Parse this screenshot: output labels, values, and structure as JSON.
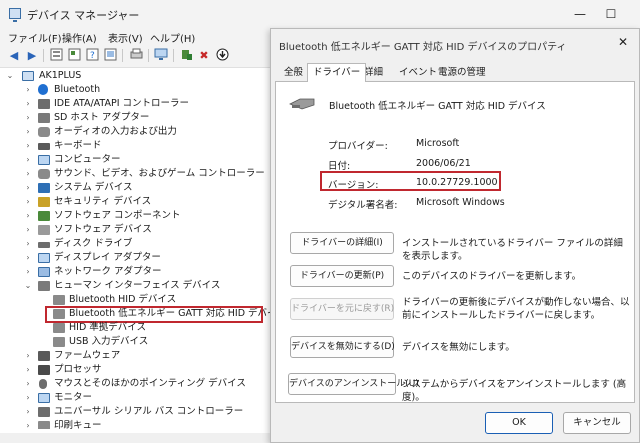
{
  "device_manager": {
    "title": "デバイス マネージャー",
    "window_controls": {
      "minimize": "—",
      "maximize": "☐",
      "close": "✕"
    },
    "menu": [
      "ファイル(F)",
      "操作(A)",
      "表示(V)",
      "ヘルプ(H)"
    ],
    "toolbar_icons": [
      "back-icon",
      "forward-icon",
      "properties-icon",
      "driver-icon",
      "help-icon",
      "view-icon",
      "print-icon",
      "monitor-icon",
      "update-driver-icon",
      "uninstall-icon",
      "scan-icon"
    ],
    "tree": {
      "root": "AK1PLUS",
      "categories": [
        {
          "label": "Bluetooth",
          "expanded": false
        },
        {
          "label": "IDE ATA/ATAPI コントローラー",
          "expanded": false
        },
        {
          "label": "SD ホスト アダプター",
          "expanded": false
        },
        {
          "label": "オーディオの入力および出力",
          "expanded": false
        },
        {
          "label": "キーボード",
          "expanded": false
        },
        {
          "label": "コンピューター",
          "expanded": false
        },
        {
          "label": "サウンド、ビデオ、およびゲーム コントローラー",
          "expanded": false
        },
        {
          "label": "システム デバイス",
          "expanded": false
        },
        {
          "label": "セキュリティ デバイス",
          "expanded": false
        },
        {
          "label": "ソフトウェア コンポーネント",
          "expanded": false
        },
        {
          "label": "ソフトウェア デバイス",
          "expanded": false
        },
        {
          "label": "ディスク ドライブ",
          "expanded": false
        },
        {
          "label": "ディスプレイ アダプター",
          "expanded": false
        },
        {
          "label": "ネットワーク アダプター",
          "expanded": false
        },
        {
          "label": "ヒューマン インターフェイス デバイス",
          "expanded": true,
          "children": [
            "Bluetooth HID デバイス",
            "Bluetooth 低エネルギー GATT 対応 HID デバイス",
            "HID 準拠デバイス",
            "USB 入力デバイス"
          ]
        },
        {
          "label": "ファームウェア",
          "expanded": false
        },
        {
          "label": "プロセッサ",
          "expanded": false
        },
        {
          "label": "マウスとそのほかのポインティング デバイス",
          "expanded": false
        },
        {
          "label": "モニター",
          "expanded": false
        },
        {
          "label": "ユニバーサル シリアル バス コントローラー",
          "expanded": false
        },
        {
          "label": "印刷キュー",
          "expanded": false
        }
      ],
      "selected_child": "Bluetooth 低エネルギー GATT 対応 HID デバイス"
    }
  },
  "properties_dialog": {
    "title": "Bluetooth 低エネルギー GATT 対応 HID デバイスのプロパティ",
    "close": "✕",
    "tabs": [
      "全般",
      "ドライバー",
      "詳細",
      "イベント",
      "電源の管理"
    ],
    "active_tab": "ドライバー",
    "device_name": "Bluetooth 低エネルギー GATT 対応 HID デバイス",
    "properties": {
      "provider_label": "プロバイダー:",
      "provider_value": "Microsoft",
      "date_label": "日付:",
      "date_value": "2006/06/21",
      "version_label": "バージョン:",
      "version_value": "10.0.27729.1000",
      "signer_label": "デジタル署名者:",
      "signer_value": "Microsoft Windows"
    },
    "actions": [
      {
        "button": "ドライバーの詳細(I)",
        "description": "インストールされているドライバー ファイルの詳細を表示します。",
        "enabled": true
      },
      {
        "button": "ドライバーの更新(P)",
        "description": "このデバイスのドライバーを更新します。",
        "enabled": true
      },
      {
        "button": "ドライバーを元に戻す(R)",
        "description": "ドライバーの更新後にデバイスが動作しない場合、以前にインストールしたドライバーに戻します。",
        "enabled": false
      },
      {
        "button": "デバイスを無効にする(D)",
        "description": "デバイスを無効にします。",
        "enabled": true
      },
      {
        "button": "デバイスのアンインストール(U)",
        "description": "システムからデバイスをアンインストールします (高度)。",
        "enabled": true
      }
    ],
    "ok_label": "OK",
    "cancel_label": "キャンセル"
  },
  "colors": {
    "highlight_border": "#c0282f",
    "bluetooth_blue": "#1f6fd1",
    "window_bg": "#f3f3f3",
    "dialog_bg": "#f0f0f0"
  }
}
